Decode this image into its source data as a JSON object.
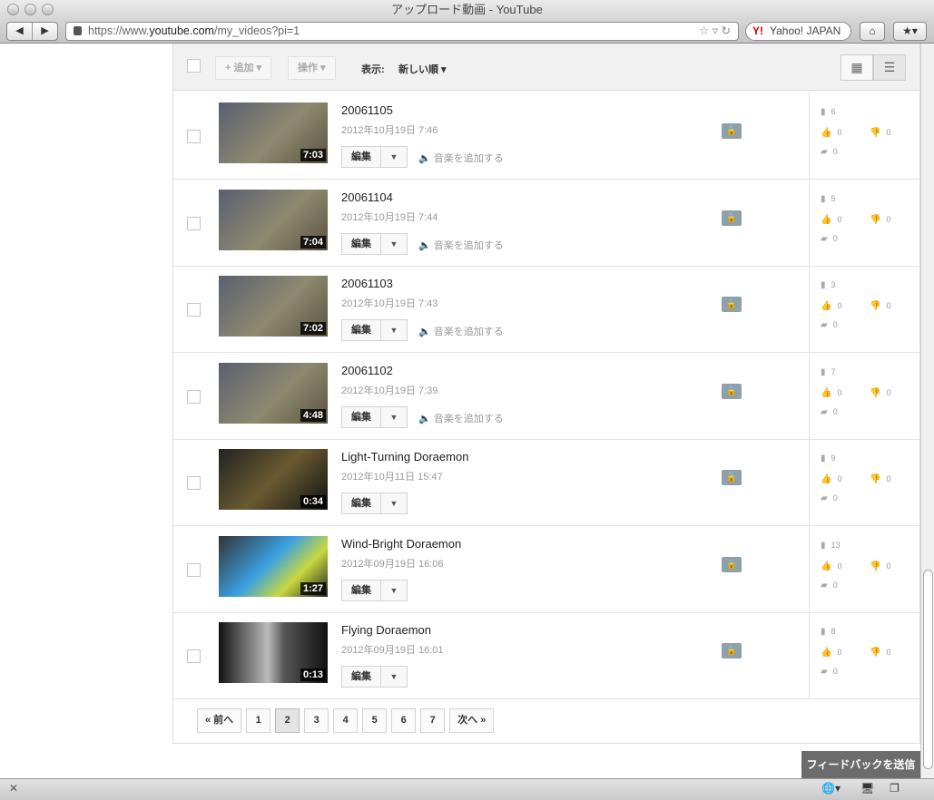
{
  "window": {
    "title": "アップロード動画 - YouTube"
  },
  "browser": {
    "url_pre": "https://www.",
    "url_host": "youtube.com",
    "url_path": "/my_videos?pi=1",
    "search": "Yahoo! JAPAN",
    "back": "◀",
    "forward": "▶",
    "home": "⌂",
    "bookmark": "★▾"
  },
  "toolbar": {
    "add": "+ 追加 ▾",
    "actions": "操作 ▾",
    "view_label": "表示:",
    "sort": "新しい順 ▾",
    "grid": "▦",
    "list": "☰"
  },
  "common": {
    "edit": "編集",
    "dropdown": "▼",
    "add_music": "🔈 音楽を追加する",
    "private": "🔒"
  },
  "videos": [
    {
      "title": "20061105",
      "date": "2012年10月19日 7:46",
      "duration": "7:03",
      "views": "6",
      "likes": "0",
      "dislikes": "0",
      "comments": "0",
      "music": true,
      "thumb": "stage"
    },
    {
      "title": "20061104",
      "date": "2012年10月19日 7:44",
      "duration": "7:04",
      "views": "5",
      "likes": "0",
      "dislikes": "0",
      "comments": "0",
      "music": true,
      "thumb": "stage"
    },
    {
      "title": "20061103",
      "date": "2012年10月19日 7:43",
      "duration": "7:02",
      "views": "3",
      "likes": "0",
      "dislikes": "0",
      "comments": "0",
      "music": true,
      "thumb": "stage"
    },
    {
      "title": "20061102",
      "date": "2012年10月19日 7:39",
      "duration": "4:48",
      "views": "7",
      "likes": "0",
      "dislikes": "0",
      "comments": "0",
      "music": true,
      "thumb": "stage"
    },
    {
      "title": "Light-Turning Doraemon",
      "date": "2012年10月11日 15:47",
      "duration": "0:34",
      "views": "9",
      "likes": "0",
      "dislikes": "0",
      "comments": "0",
      "music": false,
      "thumb": "dark"
    },
    {
      "title": "Wind-Bright Doraemon",
      "date": "2012年09月19日 16:06",
      "duration": "1:27",
      "views": "13",
      "likes": "0",
      "dislikes": "0",
      "comments": "0",
      "music": false,
      "thumb": "dora"
    },
    {
      "title": "Flying Doraemon",
      "date": "2012年09月19日 16:01",
      "duration": "0:13",
      "views": "8",
      "likes": "0",
      "dislikes": "0",
      "comments": "0",
      "music": false,
      "thumb": "hall"
    }
  ],
  "pager": {
    "prev": "« 前へ",
    "pages": [
      "1",
      "2",
      "3",
      "4",
      "5",
      "6",
      "7"
    ],
    "current": "2",
    "next": "次へ »"
  },
  "feedback": "フィードバックを送信"
}
